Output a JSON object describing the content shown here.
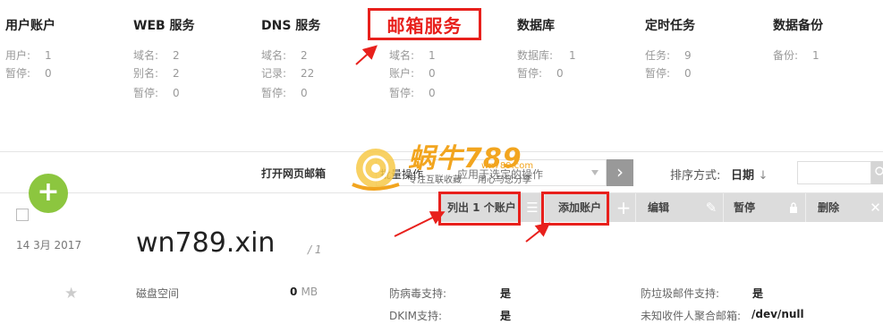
{
  "stats": {
    "users": {
      "title": "用户账户",
      "rows": [
        {
          "k": "用户:",
          "v": "1"
        },
        {
          "k": "暂停:",
          "v": "0"
        }
      ]
    },
    "web": {
      "title": "WEB 服务",
      "rows": [
        {
          "k": "域名:",
          "v": "2"
        },
        {
          "k": "别名:",
          "v": "2"
        },
        {
          "k": "暂停:",
          "v": "0"
        }
      ]
    },
    "dns": {
      "title": "DNS 服务",
      "rows": [
        {
          "k": "域名:",
          "v": "2"
        },
        {
          "k": "记录:",
          "v": "22"
        },
        {
          "k": "暂停:",
          "v": "0"
        }
      ]
    },
    "mail": {
      "title": "邮箱服务",
      "rows": [
        {
          "k": "域名:",
          "v": "1"
        },
        {
          "k": "账户:",
          "v": "0"
        },
        {
          "k": "暂停:",
          "v": "0"
        }
      ]
    },
    "db": {
      "title": "数据库",
      "rows": [
        {
          "k": "数据库:",
          "v": "1"
        },
        {
          "k": "暂停:",
          "v": "0"
        }
      ]
    },
    "cron": {
      "title": "定时任务",
      "rows": [
        {
          "k": "任务:",
          "v": "9"
        },
        {
          "k": "暂停:",
          "v": "0"
        }
      ]
    },
    "backup": {
      "title": "数据备份",
      "rows": [
        {
          "k": "备份:",
          "v": "1"
        }
      ]
    }
  },
  "toolbar": {
    "open_webmail": "打开网页邮箱",
    "bulk_label": "批量操作",
    "bulk_placeholder": "应用于选定的操作",
    "sort_label": "排序方式:",
    "sort_value": "日期",
    "sort_arrow": "↓",
    "apply_icon": "›",
    "search_placeholder": ""
  },
  "watermark": {
    "brand": "蜗牛789",
    "site": "wn789.com",
    "tag1": "专注互联收藏",
    "tag2": "用心与您分享"
  },
  "actions": {
    "list_accounts": "列出 1 个账户",
    "add_account": "添加账户",
    "edit": "编辑",
    "suspend": "暂停",
    "delete": "删除"
  },
  "record": {
    "add_symbol": "+",
    "date": "14  3月  2017",
    "domain": "wn789.xin",
    "alias_count": "/ 1",
    "star": "★",
    "disk_label": "磁盘空间",
    "disk_value": "0",
    "disk_unit": "MB",
    "antivirus_label": "防病毒支持:",
    "antivirus_value": "是",
    "dkim_label": "DKIM支持:",
    "dkim_value": "是",
    "antispam_label": "防垃圾邮件支持:",
    "antispam_value": "是",
    "catchall_label": "未知收件人聚合邮箱:",
    "catchall_value": "/dev/null"
  },
  "colors": {
    "annotation_red": "#e8201c",
    "fab_green": "#8cc63f",
    "action_bar": "#dcdcdc",
    "watermark_orange": "#f2a51f"
  }
}
